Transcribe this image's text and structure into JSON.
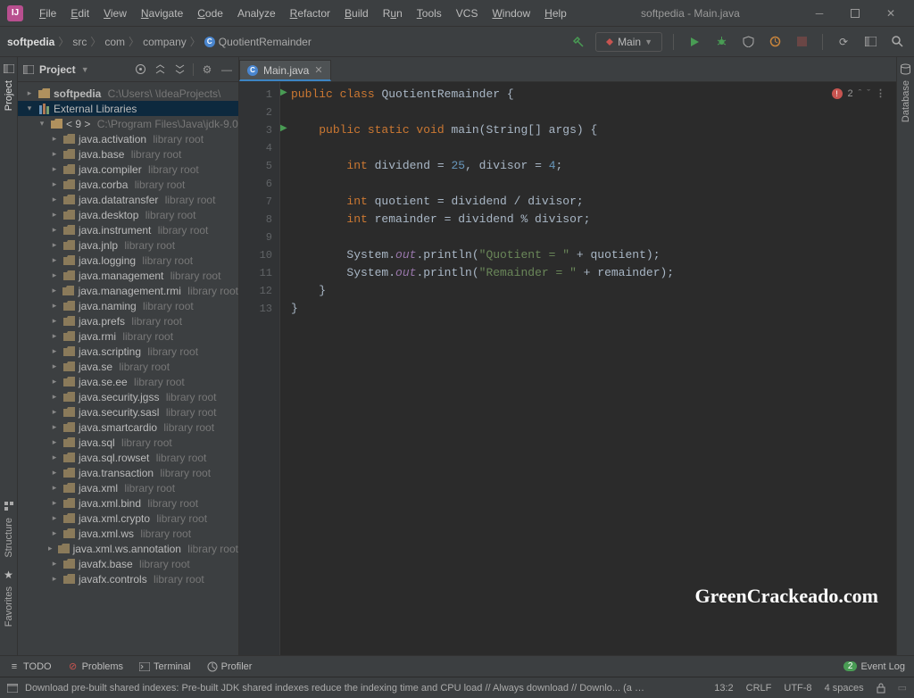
{
  "window": {
    "title": "softpedia - Main.java"
  },
  "menu": [
    {
      "l": "File",
      "u": "F"
    },
    {
      "l": "Edit",
      "u": "E"
    },
    {
      "l": "View",
      "u": "V"
    },
    {
      "l": "Navigate",
      "u": "N"
    },
    {
      "l": "Code",
      "u": "C"
    },
    {
      "l": "Analyze",
      "u": null
    },
    {
      "l": "Refactor",
      "u": "R"
    },
    {
      "l": "Build",
      "u": "B"
    },
    {
      "l": "Run",
      "u": "u"
    },
    {
      "l": "Tools",
      "u": "T"
    },
    {
      "l": "VCS",
      "u": null
    },
    {
      "l": "Window",
      "u": "W"
    },
    {
      "l": "Help",
      "u": "H"
    }
  ],
  "breadcrumb": {
    "project": "softpedia",
    "parts": [
      "src",
      "com",
      "company"
    ],
    "file": "QuotientRemainder"
  },
  "run_config": "Main",
  "left_rail": {
    "project": "Project",
    "structure": "Structure",
    "favorites": "Favorites"
  },
  "right_rail": {
    "database": "Database"
  },
  "project_panel": {
    "title": "Project",
    "root": {
      "name": "softpedia",
      "path": "C:\\Users\\        \\IdeaProjects\\"
    },
    "ext_label": "External Libraries",
    "jdk": {
      "name": "< 9 >",
      "path": "C:\\Program Files\\Java\\jdk-9.0"
    },
    "libs": [
      "java.activation",
      "java.base",
      "java.compiler",
      "java.corba",
      "java.datatransfer",
      "java.desktop",
      "java.instrument",
      "java.jnlp",
      "java.logging",
      "java.management",
      "java.management.rmi",
      "java.naming",
      "java.prefs",
      "java.rmi",
      "java.scripting",
      "java.se",
      "java.se.ee",
      "java.security.jgss",
      "java.security.sasl",
      "java.smartcardio",
      "java.sql",
      "java.sql.rowset",
      "java.transaction",
      "java.xml",
      "java.xml.bind",
      "java.xml.crypto",
      "java.xml.ws",
      "java.xml.ws.annotation",
      "javafx.base",
      "javafx.controls"
    ],
    "lib_suffix": "library root"
  },
  "editor": {
    "tab": "Main.java",
    "errors": "2",
    "gutter": [
      "1",
      "2",
      "3",
      "4",
      "5",
      "6",
      "7",
      "8",
      "9",
      "10",
      "11",
      "12",
      "13"
    ],
    "code_html": "<span class='kw'>public class</span> <span class='cls'>QuotientRemainder</span> {\n\n    <span class='kw'>public static void</span> main(String[] args) {\n\n        <span class='kw'>int</span> dividend = <span class='num'>25</span>, divisor = <span class='num'>4</span>;\n\n        <span class='kw'>int</span> quotient = dividend / divisor;\n        <span class='kw'>int</span> remainder = dividend % divisor;\n\n        System.<span class='fld'>out</span>.println(<span class='str'>\"Quotient = \"</span> + quotient);\n        System.<span class='fld'>out</span>.println(<span class='str'>\"Remainder = \"</span> + remainder);\n    }\n}"
  },
  "status_top": {
    "todo": "TODO",
    "problems": "Problems",
    "terminal": "Terminal",
    "profiler": "Profiler",
    "event": "Event Log",
    "event_badge": "2"
  },
  "status_bottom": {
    "msg": "Download pre-built shared indexes: Pre-built JDK shared indexes reduce the indexing time and CPU load // Always download // Downlo... (a minute a",
    "pos": "13:2",
    "eol": "CRLF",
    "enc": "UTF-8",
    "indent": "4 spaces"
  },
  "watermark": "GreenCrackeado.com"
}
